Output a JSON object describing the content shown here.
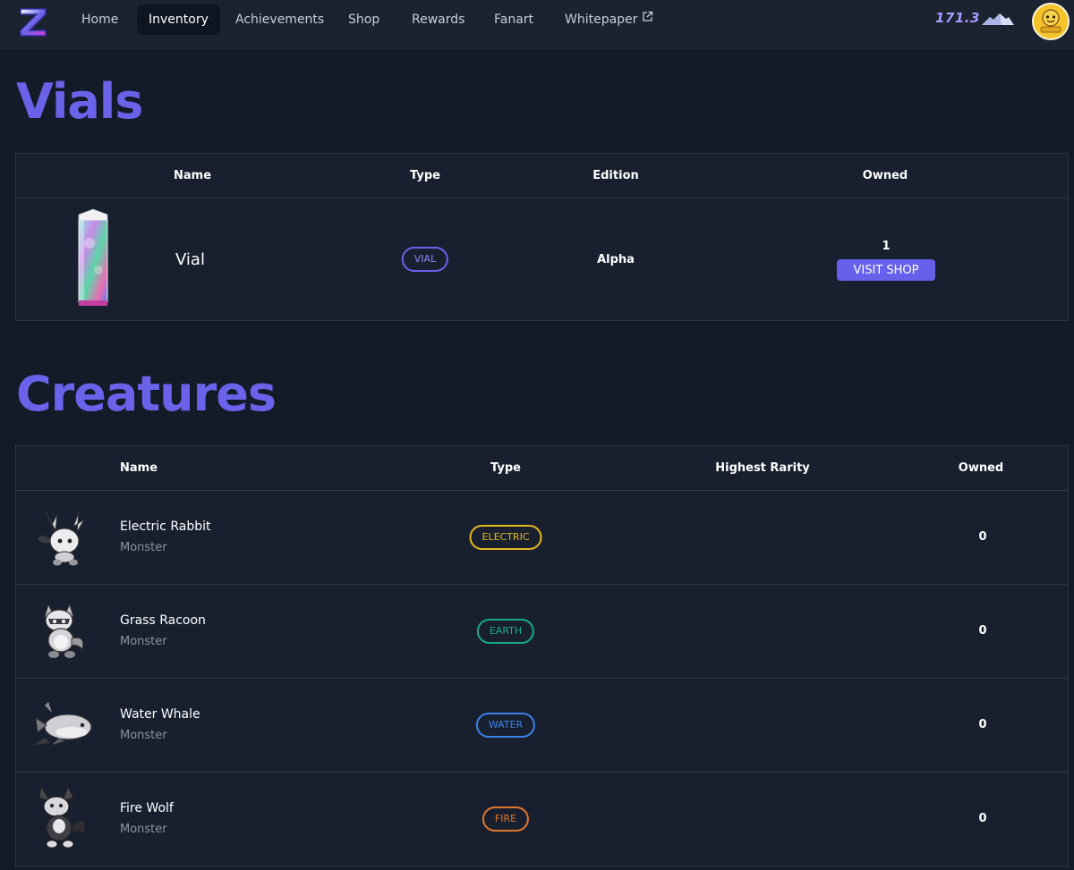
{
  "nav": {
    "items": [
      {
        "label": "Home",
        "active": false
      },
      {
        "label": "Inventory",
        "active": true
      },
      {
        "label": "Achievements",
        "active": false
      },
      {
        "label": "Shop",
        "active": false
      },
      {
        "label": "Rewards",
        "active": false
      },
      {
        "label": "Fanart",
        "active": false
      },
      {
        "label": "Whitepaper",
        "active": false,
        "icon": "external-link-icon"
      }
    ],
    "balance": "171.3",
    "balance_icon": "mountain-icon"
  },
  "vials": {
    "title": "Vials",
    "columns": [
      "Name",
      "Type",
      "Edition",
      "Owned"
    ],
    "rows": [
      {
        "name": "Vial",
        "type": "VIAL",
        "edition": "Alpha",
        "owned": "1",
        "action": "VISIT SHOP"
      }
    ]
  },
  "creatures": {
    "title": "Creatures",
    "columns": [
      "Name",
      "Type",
      "Highest Rarity",
      "Owned"
    ],
    "rows": [
      {
        "name": "Electric Rabbit",
        "category": "Monster",
        "type": "ELECTRIC",
        "type_color": "#e5b81f",
        "owned": "0"
      },
      {
        "name": "Grass Racoon",
        "category": "Monster",
        "type": "EARTH",
        "type_color": "#1aa987",
        "owned": "0"
      },
      {
        "name": "Water Whale",
        "category": "Monster",
        "type": "WATER",
        "type_color": "#3b82e6",
        "owned": "0"
      },
      {
        "name": "Fire Wolf",
        "category": "Monster",
        "type": "FIRE",
        "type_color": "#e1772a",
        "owned": "0"
      }
    ]
  },
  "colors": {
    "accent": "#6a63ea",
    "background": "#131a28",
    "table_bg": "#182030",
    "vial_pill": "#6a63ea"
  }
}
